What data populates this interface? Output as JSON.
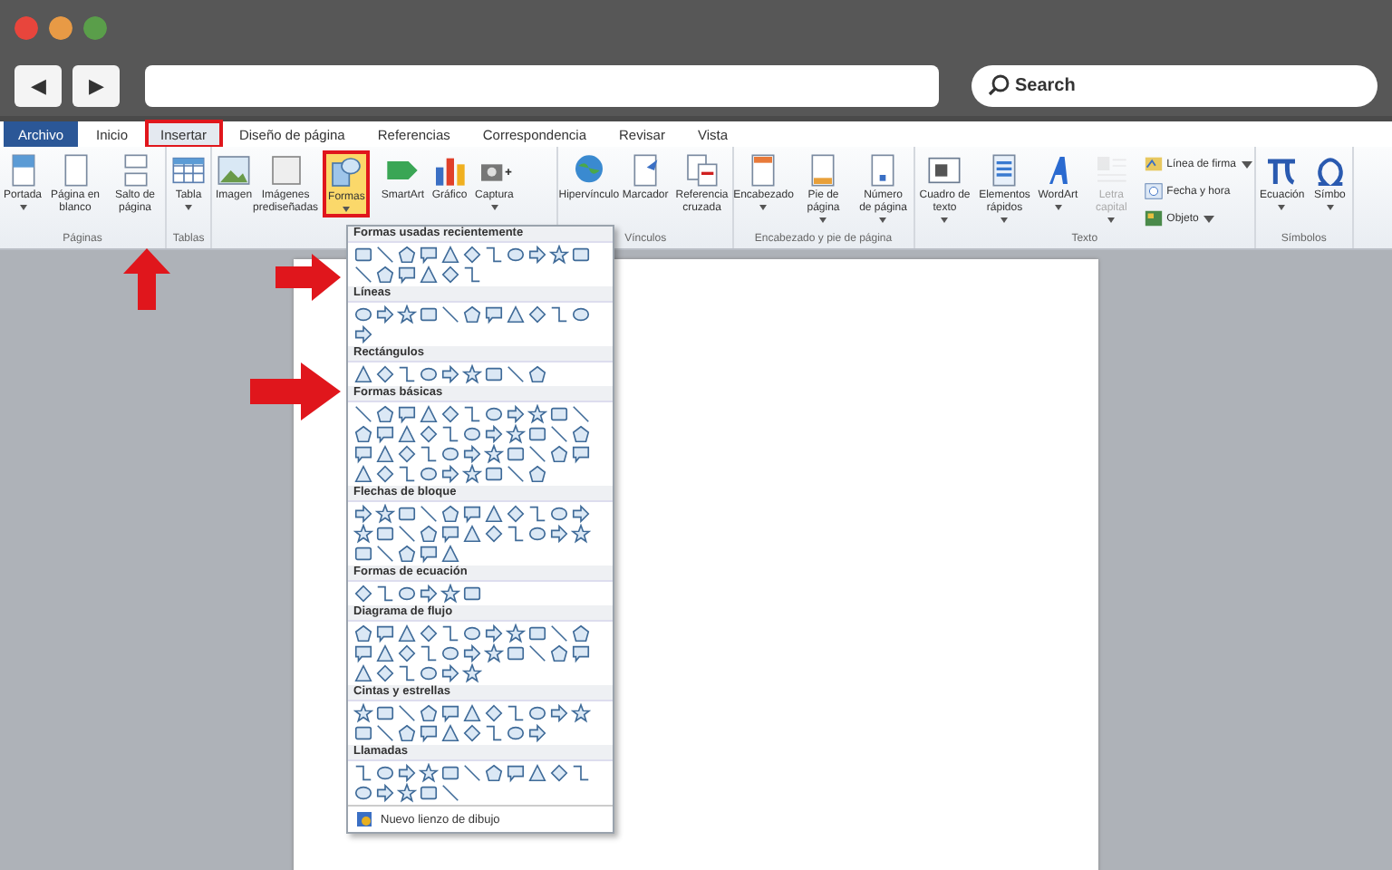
{
  "browser": {
    "back_button": "◀",
    "forward_button": "▶",
    "search": {
      "placeholder": "Search"
    }
  },
  "tabs": [
    {
      "label": "Archivo",
      "kind": "file",
      "selected": false,
      "highlighted": false
    },
    {
      "label": "Inicio",
      "kind": "tab",
      "selected": false,
      "highlighted": false
    },
    {
      "label": "Insertar",
      "kind": "tab",
      "selected": true,
      "highlighted": true
    },
    {
      "label": "Diseño de página",
      "kind": "tab",
      "selected": false,
      "highlighted": false
    },
    {
      "label": "Referencias",
      "kind": "tab",
      "selected": false,
      "highlighted": false
    },
    {
      "label": "Correspondencia",
      "kind": "tab",
      "selected": false,
      "highlighted": false
    },
    {
      "label": "Revisar",
      "kind": "tab",
      "selected": false,
      "highlighted": false
    },
    {
      "label": "Vista",
      "kind": "tab",
      "selected": false,
      "highlighted": false
    }
  ],
  "ribbon_groups": [
    {
      "label": "Páginas",
      "items": [
        {
          "label": "Portada",
          "kind": "large",
          "dropdown": true,
          "highlighted": false,
          "disabled": false
        },
        {
          "label": "Página en blanco",
          "kind": "large",
          "dropdown": false,
          "highlighted": false,
          "disabled": false
        },
        {
          "label": "Salto de página",
          "kind": "large",
          "dropdown": false,
          "highlighted": false,
          "disabled": false
        }
      ]
    },
    {
      "label": "Tablas",
      "items": [
        {
          "label": "Tabla",
          "kind": "large",
          "dropdown": true,
          "highlighted": false,
          "disabled": false
        }
      ]
    },
    {
      "items": [
        {
          "label": "Imagen",
          "kind": "large",
          "dropdown": false,
          "highlighted": false,
          "disabled": false
        },
        {
          "label": "Imágenes prediseñadas",
          "kind": "large",
          "dropdown": false,
          "highlighted": false,
          "disabled": false
        },
        {
          "label": "Formas",
          "kind": "large",
          "dropdown": true,
          "highlighted": true,
          "disabled": false
        },
        {
          "label": "SmartArt",
          "kind": "large",
          "dropdown": false,
          "highlighted": false,
          "disabled": false
        },
        {
          "label": "Gráfico",
          "kind": "large",
          "dropdown": false,
          "highlighted": false,
          "disabled": false
        },
        {
          "label": "Captura",
          "kind": "large",
          "dropdown": true,
          "highlighted": false,
          "disabled": false
        }
      ]
    },
    {
      "label": "Vínculos",
      "items": [
        {
          "label": "Hipervínculo",
          "kind": "large",
          "dropdown": false,
          "highlighted": false,
          "disabled": false
        },
        {
          "label": "Marcador",
          "kind": "large",
          "dropdown": false,
          "highlighted": false,
          "disabled": false
        },
        {
          "label": "Referencia cruzada",
          "kind": "large",
          "dropdown": false,
          "highlighted": false,
          "disabled": false
        }
      ]
    },
    {
      "label": "Encabezado y pie de página",
      "items": [
        {
          "label": "Encabezado",
          "kind": "large",
          "dropdown": true,
          "highlighted": false,
          "disabled": false
        },
        {
          "label": "Pie de página",
          "kind": "large",
          "dropdown": true,
          "highlighted": false,
          "disabled": false
        },
        {
          "label": "Número de página",
          "kind": "large",
          "dropdown": true,
          "highlighted": false,
          "disabled": false
        }
      ]
    },
    {
      "label": "Texto",
      "items": [
        {
          "label": "Cuadro de texto",
          "kind": "large",
          "dropdown": true,
          "highlighted": false,
          "disabled": false
        },
        {
          "label": "Elementos rápidos",
          "kind": "large",
          "dropdown": true,
          "highlighted": false,
          "disabled": false
        },
        {
          "label": "WordArt",
          "kind": "large",
          "dropdown": true,
          "highlighted": false,
          "disabled": false
        },
        {
          "label": "Letra capital",
          "kind": "large",
          "dropdown": true,
          "highlighted": false,
          "disabled": true
        },
        {
          "label": "Línea de firma",
          "kind": "small",
          "dropdown": true,
          "highlighted": false,
          "disabled": false
        },
        {
          "label": "Fecha y hora",
          "kind": "small",
          "dropdown": false,
          "highlighted": false,
          "disabled": false
        },
        {
          "label": "Objeto",
          "kind": "small",
          "dropdown": true,
          "highlighted": false,
          "disabled": false
        }
      ]
    },
    {
      "label": "Símbolos",
      "items": [
        {
          "label": "Ecuación",
          "kind": "large",
          "dropdown": true,
          "highlighted": false,
          "disabled": false
        },
        {
          "label": "Símbo",
          "kind": "large",
          "dropdown": true,
          "highlighted": false,
          "disabled": false
        }
      ]
    }
  ],
  "shapes_menu": {
    "sections": [
      {
        "title": "Formas usadas recientemente"
      },
      {
        "title": "Líneas"
      },
      {
        "title": "Rectángulos"
      },
      {
        "title": "Formas básicas"
      },
      {
        "title": "Flechas de bloque"
      },
      {
        "title": "Formas de ecuación"
      },
      {
        "title": "Diagrama de flujo"
      },
      {
        "title": "Cintas y estrellas"
      },
      {
        "title": "Llamadas"
      }
    ],
    "footer": "Nuevo lienzo de dibujo"
  }
}
